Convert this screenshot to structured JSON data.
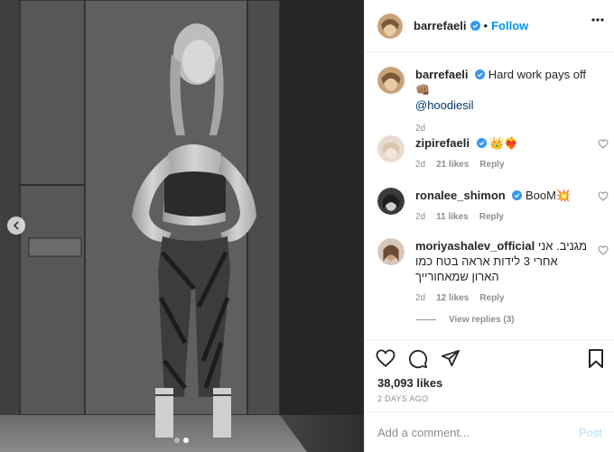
{
  "header": {
    "username": "barrefaeli",
    "separator": "•",
    "follow_label": "Follow"
  },
  "caption": {
    "username": "barrefaeli",
    "text": "Hard work pays off 👊🏽",
    "mention": "@hoodiesil",
    "time": "2d"
  },
  "comments": [
    {
      "username": "zipirefaeli",
      "text": "👑❤️‍🔥",
      "time": "2d",
      "likes": "21 likes",
      "reply_label": "Reply"
    },
    {
      "username": "ronalee_shimon",
      "text": "BooM💥",
      "time": "2d",
      "likes": "11 likes",
      "reply_label": "Reply"
    },
    {
      "username": "moriyashalev_official",
      "text": "מגניב. אני",
      "text2": "אחרי 3 לידות אראה בטח כמו",
      "text3": "הארון שמאחורייך",
      "time": "2d",
      "likes": "12 likes",
      "reply_label": "Reply"
    }
  ],
  "view_replies": "View replies (3)",
  "stats": {
    "likes": "38,093 likes",
    "date": "2 DAYS AGO"
  },
  "add_comment": {
    "placeholder": "Add a comment...",
    "post_label": "Post"
  },
  "icons": {
    "more": "more-options-icon",
    "like": "heart-icon",
    "comment": "comment-icon",
    "share": "share-icon",
    "save": "bookmark-icon",
    "verified": "verified-badge-icon"
  },
  "colors": {
    "link": "#0095f6",
    "muted": "#8e8e8e",
    "post_disabled": "#b2dffc"
  },
  "carousel": {
    "slide_count": 2,
    "active_slide": 2
  }
}
